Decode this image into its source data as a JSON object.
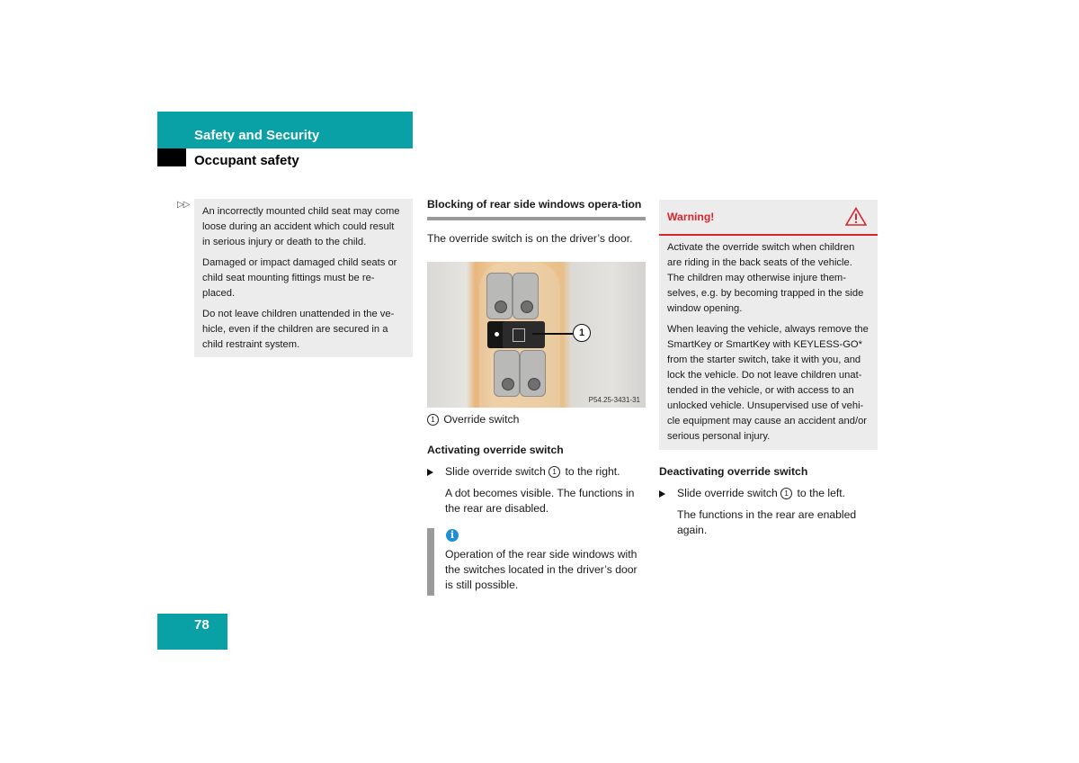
{
  "header": {
    "section_title": "Safety and Security",
    "subsection_title": "Occupant safety",
    "accent_color": "#0aa1a6"
  },
  "continuation_marker": "▷▷",
  "left_box": {
    "paragraphs": [
      "An incorrectly mounted child seat may come loose during an accident which could result in serious injury or death to the child.",
      "Damaged or impact damaged child seats or child seat mounting fittings must be re-placed.",
      "Do not leave children unattended in the ve-hicle, even if the children are secured in a child restraint system."
    ]
  },
  "middle": {
    "heading": "Blocking of rear side windows opera-tion",
    "intro": "The override switch is on the driver’s door.",
    "figure": {
      "callout_number": "1",
      "code": "P54.25-3431-31",
      "caption_number": "1",
      "caption": "Override switch"
    },
    "activating": {
      "heading": "Activating override switch",
      "step_prefix": "Slide override switch",
      "step_ref": "1",
      "step_suffix": "to the right.",
      "result": "A dot becomes visible. The functions in the rear are disabled."
    },
    "info": {
      "icon": "info-icon",
      "text": "Operation of the rear side windows with the switches located in the driver’s door is still possible."
    }
  },
  "warning": {
    "title": "Warning!",
    "icon": "warning-triangle-icon",
    "color": "#d8242c",
    "paragraphs": [
      "Activate the override switch when children are riding in the back seats of the vehicle. The children may otherwise injure them-selves, e.g. by becoming trapped in the side window opening.",
      "When leaving the vehicle, always remove the SmartKey or SmartKey with KEYLESS-GO* from the starter switch, take it with you, and lock the vehicle. Do not leave children unat-tended in the vehicle, or with access to an unlocked vehicle. Unsupervised use of vehi-cle equipment may cause an accident and/or serious personal injury."
    ]
  },
  "deactivating": {
    "heading": "Deactivating override switch",
    "step_prefix": "Slide override switch",
    "step_ref": "1",
    "step_suffix": "to the left.",
    "result": "The functions in the rear are enabled again."
  },
  "page_number": "78"
}
